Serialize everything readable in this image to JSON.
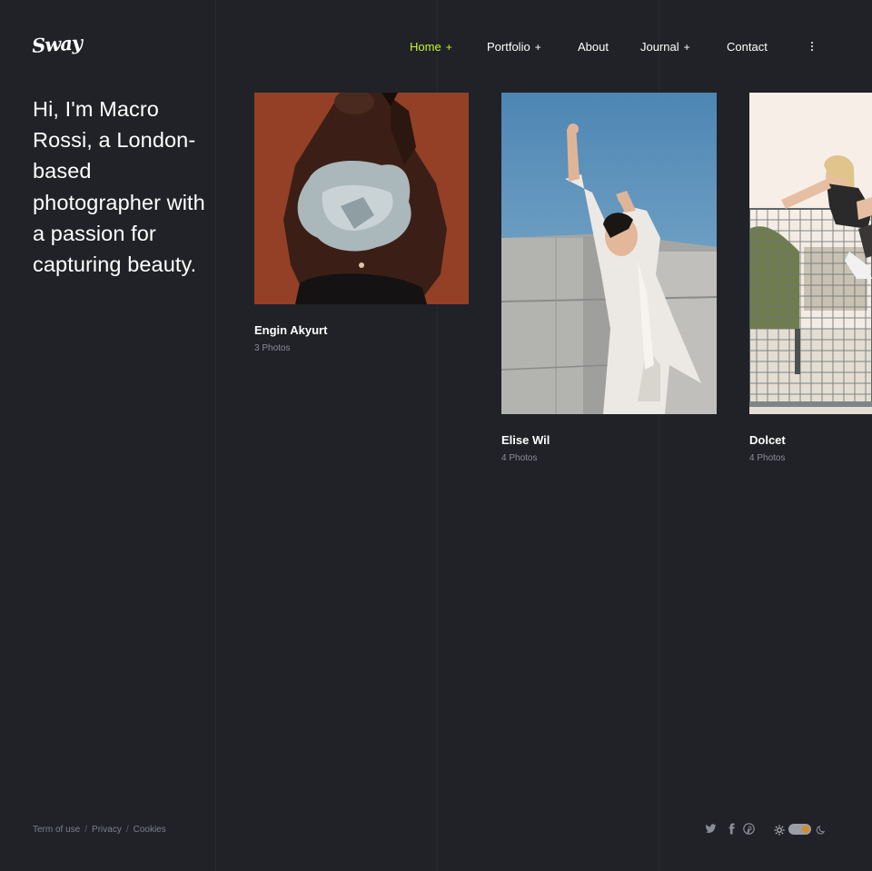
{
  "brand": {
    "logo_text": "Sway"
  },
  "nav": {
    "items": [
      {
        "label": "Home",
        "plus": "+",
        "active": true
      },
      {
        "label": "Portfolio",
        "plus": "+"
      },
      {
        "label": "About",
        "plus": ""
      },
      {
        "label": "Journal",
        "plus": "+"
      },
      {
        "label": "Contact",
        "plus": ""
      }
    ],
    "more_icon": "vertical-dots-icon"
  },
  "intro": {
    "text": "Hi, I'm Macro Rossi, a London-based photographer with a passion for capturing beauty."
  },
  "galleries": [
    {
      "title": "Engin Akyurt",
      "count": "3 Photos",
      "photo": "woman-rust-background-photo"
    },
    {
      "title": "Elise Wil",
      "count": "4 Photos",
      "photo": "woman-white-outfit-sky-photo"
    },
    {
      "title": "Dolcet",
      "count": "4 Photos",
      "photo": "woman-on-fence-photo"
    }
  ],
  "footer": {
    "links": [
      "Term of use",
      "Privacy",
      "Cookies"
    ],
    "separator": "/",
    "social": [
      "twitter-icon",
      "facebook-icon",
      "pinterest-icon"
    ],
    "theme_toggle": {
      "light_icon": "sun-icon",
      "dark_icon": "moon-icon"
    }
  },
  "colors": {
    "background": "#202227",
    "accent": "#c8f031",
    "muted_text": "#7d8088"
  }
}
